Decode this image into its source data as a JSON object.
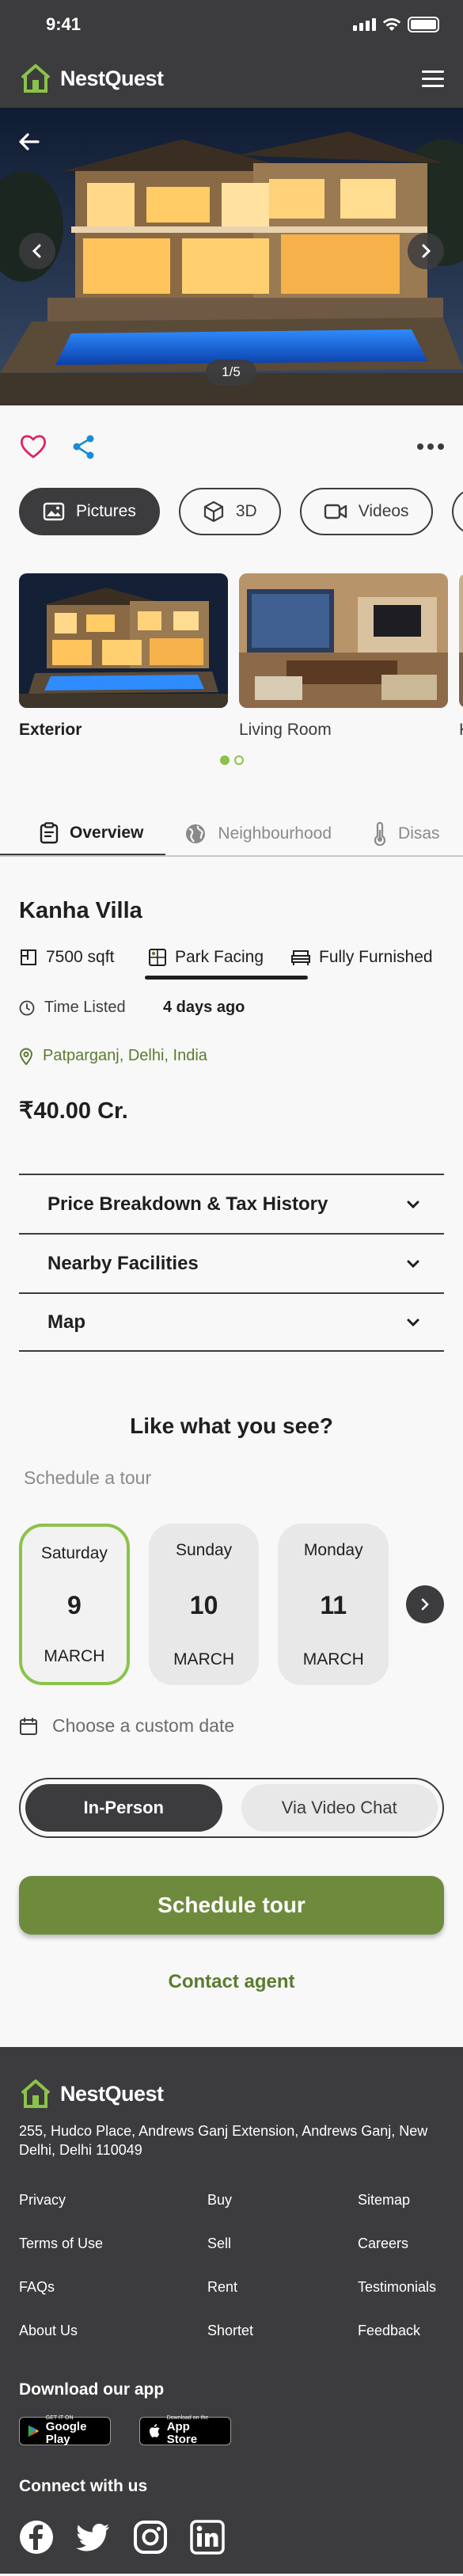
{
  "status": {
    "time": "9:41"
  },
  "header": {
    "brand": "NestQuest"
  },
  "hero": {
    "counter": "1/5"
  },
  "media_tabs": [
    {
      "label": "Pictures",
      "icon": "image-icon",
      "active": true
    },
    {
      "label": "3D",
      "icon": "cube-icon",
      "active": false
    },
    {
      "label": "Videos",
      "icon": "video-icon",
      "active": false
    }
  ],
  "gallery": [
    {
      "label": "Exterior"
    },
    {
      "label": "Living Room"
    },
    {
      "label": "K"
    }
  ],
  "section_tabs": [
    {
      "label": "Overview",
      "active": true
    },
    {
      "label": "Neighbourhood",
      "active": false
    },
    {
      "label": "Disas",
      "active": false
    }
  ],
  "property": {
    "name": "Kanha Villa",
    "area": "7500 sqft",
    "facing": "Park Facing",
    "furnishing": "Fully Furnished",
    "time_label": "Time Listed",
    "time_value": "4 days ago",
    "location": "Patparganj, Delhi, India",
    "price": "₹40.00 Cr."
  },
  "accordions": [
    {
      "label": "Price Breakdown & Tax History"
    },
    {
      "label": "Nearby Facilities"
    },
    {
      "label": "Map"
    }
  ],
  "tour": {
    "heading": "Like what you see?",
    "subheading": "Schedule a tour",
    "dates": [
      {
        "day": "Saturday",
        "num": "9",
        "month": "MARCH",
        "selected": true
      },
      {
        "day": "Sunday",
        "num": "10",
        "month": "MARCH",
        "selected": false
      },
      {
        "day": "Monday",
        "num": "11",
        "month": "MARCH",
        "selected": false
      }
    ],
    "custom_date": "Choose a custom date",
    "modes": [
      {
        "label": "In-Person",
        "active": true
      },
      {
        "label": "Via Video Chat",
        "active": false
      }
    ],
    "cta": "Schedule tour",
    "contact": "Contact agent"
  },
  "footer": {
    "brand": "NestQuest",
    "address": "255, Hudco Place, Andrews Ganj Extension, Andrews Ganj, New Delhi, Delhi 110049",
    "links": [
      "Privacy",
      "Buy",
      "Sitemap",
      "Terms of Use",
      "Sell",
      "Careers",
      "FAQs",
      "Rent",
      "Testimonials",
      "About Us",
      "Shortet",
      "Feedback"
    ],
    "download_title": "Download our app",
    "google_play": {
      "small": "GET IT ON",
      "big": "Google Play"
    },
    "app_store": {
      "small": "Download on the",
      "big": "App Store"
    },
    "connect_title": "Connect with us"
  },
  "colors": {
    "dark": "#3c3c3e",
    "accent": "#8bc34a",
    "brand_green": "#6e8b3d",
    "heart": "#e0245e",
    "share": "#1a8cd8"
  }
}
